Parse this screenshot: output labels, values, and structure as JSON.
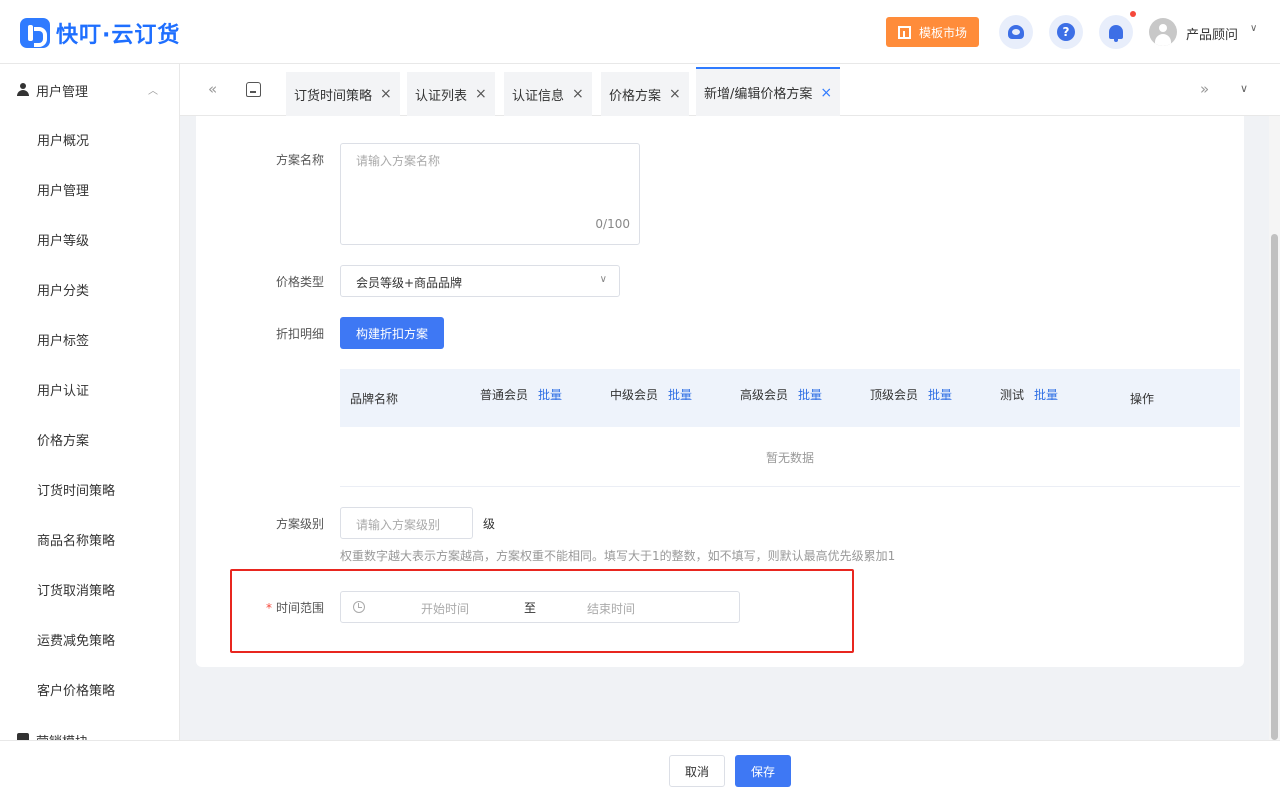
{
  "header": {
    "logo_text": "快叮·云订货",
    "template_market": "模板市场",
    "help_glyph": "?",
    "user_name": "产品顾问",
    "caret": "∨"
  },
  "sidebar": {
    "group_label": "用户管理",
    "group_caret": "︿",
    "items": [
      "用户概况",
      "用户管理",
      "用户等级",
      "用户分类",
      "用户标签",
      "用户认证",
      "价格方案",
      "订货时间策略",
      "商品名称策略",
      "订货取消策略",
      "运费减免策略",
      "客户价格策略"
    ],
    "next_group_label": "营销模块"
  },
  "tabs": {
    "nav_left": "«",
    "nav_right": "»",
    "dropdown": "∨",
    "close_glyph": "×",
    "items": [
      {
        "label": "订货时间策略"
      },
      {
        "label": "认证列表"
      },
      {
        "label": "认证信息"
      },
      {
        "label": "价格方案"
      },
      {
        "label": "新增/编辑价格方案"
      }
    ]
  },
  "form": {
    "name_label": "方案名称",
    "name_placeholder": "请输入方案名称",
    "name_count": "0/100",
    "price_type_label": "价格类型",
    "price_type_value": "会员等级+商品品牌",
    "select_caret": "∨",
    "discount_label": "折扣明细",
    "build_button": "构建折扣方案",
    "table": {
      "batch_label": "批量",
      "columns": [
        "品牌名称",
        "普通会员",
        "中级会员",
        "高级会员",
        "顶级会员",
        "测试",
        "操作"
      ],
      "empty_text": "暂无数据"
    },
    "level_label": "方案级别",
    "level_placeholder": "请输入方案级别",
    "level_unit": "级",
    "level_hint": "权重数字越大表示方案越高，方案权重不能相同。填写大于1的整数，如不填写，则默认最高优先级累加1",
    "time_required": "*",
    "time_label": "时间范围",
    "time_start": "开始时间",
    "time_sep": "至",
    "time_end": "结束时间"
  },
  "footer": {
    "cancel": "取消",
    "save": "保存"
  },
  "colors": {
    "primary": "#3e78f4",
    "orange": "#ff8c3a",
    "highlight_red": "#e8261f"
  }
}
